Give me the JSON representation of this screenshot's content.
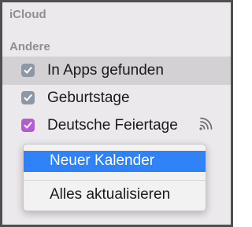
{
  "sections": {
    "icloud_title": "iCloud",
    "other_title": "Andere"
  },
  "calendars": [
    {
      "label": "In Apps gefunden",
      "checked": true,
      "color": "#8e97a6",
      "selected": true
    },
    {
      "label": "Geburtstage",
      "checked": true,
      "color": "#8e97a6",
      "selected": false
    },
    {
      "label": "Deutsche Feiertage",
      "checked": true,
      "color": "#b35bd2",
      "selected": false,
      "icon": "subscription-icon"
    }
  ],
  "context_menu": {
    "items": [
      {
        "label": "Neuer Kalender",
        "highlighted": true
      },
      {
        "label": "Alles aktualisieren",
        "highlighted": false
      }
    ]
  },
  "colors": {
    "highlight": "#2f82f7",
    "row_selected": "#d3d1d3",
    "sidebar_bg": "#ece9ec"
  }
}
